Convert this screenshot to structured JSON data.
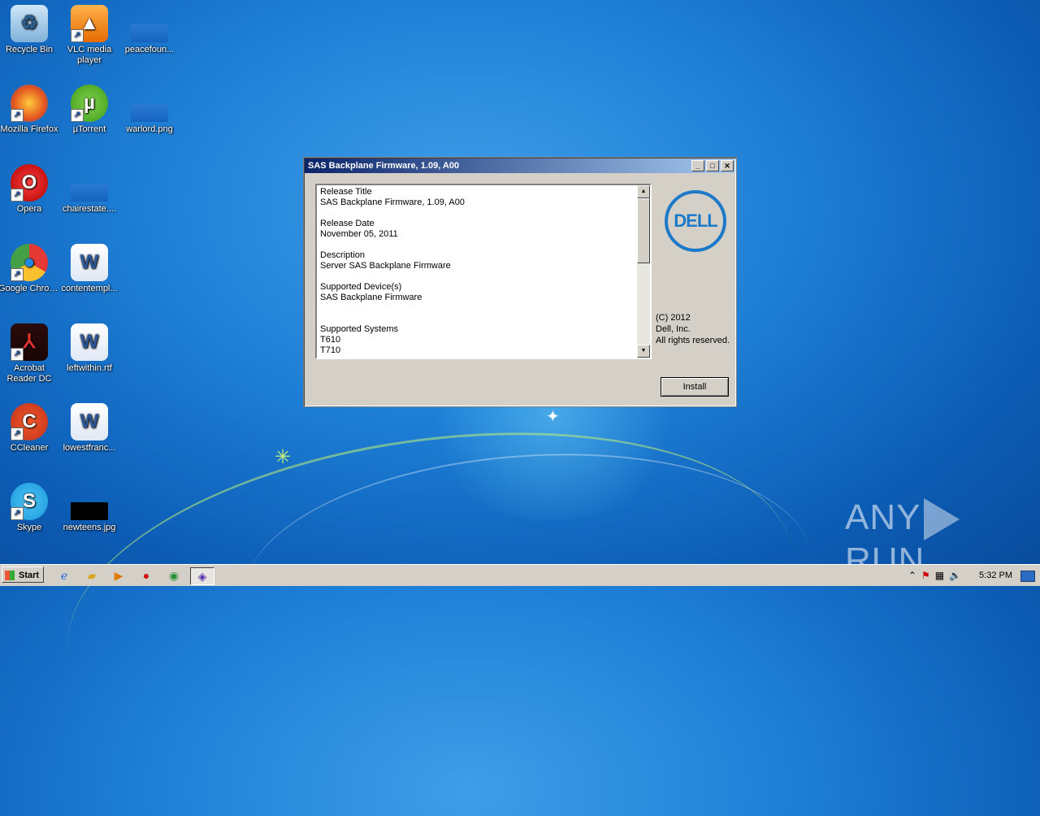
{
  "desktop": {
    "icons": [
      {
        "label": "Recycle Bin",
        "icon": "recycle-bin-icon",
        "shortcut": false
      },
      {
        "label": "VLC media player",
        "icon": "vlc-icon",
        "shortcut": true
      },
      {
        "label": "peacefoun...",
        "icon": "file-icon",
        "shortcut": false
      },
      {
        "label": "Mozilla Firefox",
        "icon": "firefox-icon",
        "shortcut": true
      },
      {
        "label": "µTorrent",
        "icon": "utorrent-icon",
        "shortcut": true
      },
      {
        "label": "warlord.png",
        "icon": "image-file-icon",
        "shortcut": false
      },
      {
        "label": "Opera",
        "icon": "opera-icon",
        "shortcut": true
      },
      {
        "label": "chairestate....",
        "icon": "file-icon",
        "shortcut": false
      },
      {
        "label": "Google Chrome",
        "icon": "chrome-icon",
        "shortcut": true
      },
      {
        "label": "contentempl...",
        "icon": "word-doc-icon",
        "shortcut": false
      },
      {
        "label": "Acrobat Reader DC",
        "icon": "acrobat-icon",
        "shortcut": true
      },
      {
        "label": "leftwithin.rtf",
        "icon": "word-doc-icon",
        "shortcut": false
      },
      {
        "label": "CCleaner",
        "icon": "ccleaner-icon",
        "shortcut": true
      },
      {
        "label": "lowestfranc...",
        "icon": "word-doc-icon",
        "shortcut": false
      },
      {
        "label": "Skype",
        "icon": "skype-icon",
        "shortcut": true
      },
      {
        "label": "newteens.jpg",
        "icon": "image-file-icon",
        "shortcut": false
      }
    ]
  },
  "window": {
    "title": "SAS Backplane Firmware, 1.09, A00",
    "info_text": "Release Title\nSAS Backplane Firmware, 1.09, A00\n\nRelease Date\nNovember 05, 2011\n\nDescription\nServer SAS Backplane Firmware\n\nSupported Device(s)\nSAS Backplane Firmware\n\n\nSupported Systems\nT610\nT710",
    "logo_text": "DELL",
    "copyright_line1": "(C) 2012",
    "copyright_line2": "Dell, Inc.",
    "copyright_line3": "All rights reserved.",
    "install_label": "Install",
    "minimize_glyph": "_",
    "maximize_glyph": "□",
    "close_glyph": "✕"
  },
  "taskbar": {
    "start_label": "Start",
    "clock": "5:32 PM"
  },
  "watermark": {
    "left": "ANY",
    "right": "RUN"
  },
  "colors": {
    "title_start": "#0a246a",
    "title_end": "#a6caf0",
    "dell_blue": "#1d7ac8"
  }
}
